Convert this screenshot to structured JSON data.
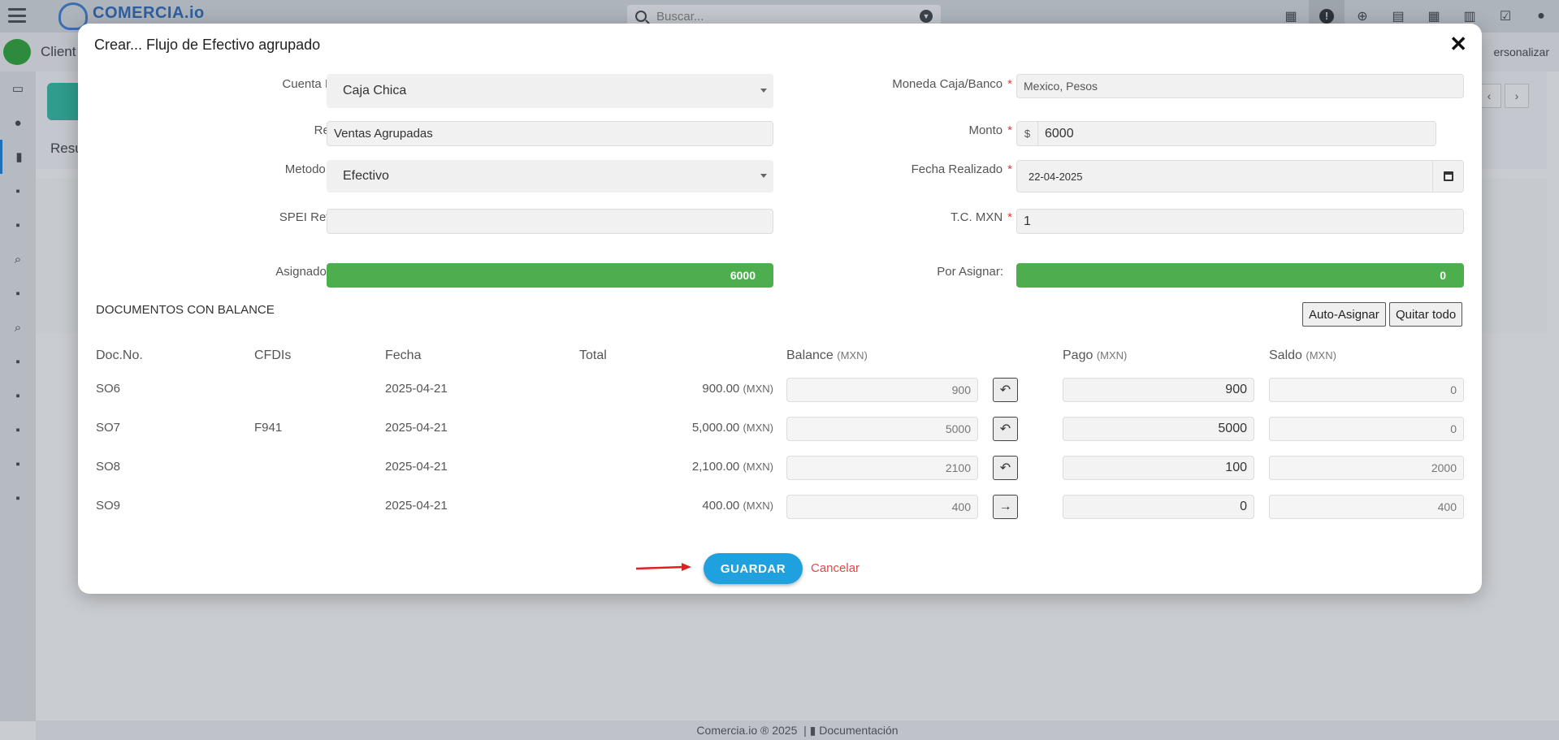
{
  "app": {
    "logo_text": "COMERCIA.io",
    "search_placeholder": "Buscar...",
    "section_label": "Client",
    "customize_label": "ersonalizar",
    "tab_label": "Resu",
    "footer_text": "Comercia.io ® 2025",
    "footer_doc_label": "Documentación"
  },
  "modal": {
    "title": "Crear... Flujo de Efectivo agrupado",
    "close_symbol": "✕",
    "fields": {
      "cuenta_label": "Cuenta Bancaria",
      "cuenta_value": "Caja Chica",
      "moneda_label": "Moneda Caja/Banco",
      "moneda_value": "Mexico, Pesos",
      "referencia_label": "Referencia",
      "referencia_value": "Ventas Agrupadas",
      "monto_label": "Monto",
      "monto_prefix": "$",
      "monto_value": "6000",
      "metodo_label": "Metodo de pago",
      "metodo_value": "Efectivo",
      "fecha_label": "Fecha Realizado",
      "fecha_value": "22-04-2025",
      "spei_label": "SPEI Ref. Numerica",
      "spei_value": "",
      "tc_label": "T.C. MXN",
      "tc_value": "1",
      "required_mark": "*"
    },
    "bars": {
      "asignado_label": "Asignado:",
      "asignado_value": "6000",
      "por_asignar_label": "Por Asignar:",
      "por_asignar_value": "0"
    },
    "documents": {
      "section_title": "DOCUMENTOS CON BALANCE",
      "auto_assign_label": "Auto-Asignar",
      "remove_all_label": "Quitar todo",
      "headers": {
        "doc_no": "Doc.No.",
        "cfdis": "CFDIs",
        "fecha": "Fecha",
        "total": "Total",
        "balance": "Balance",
        "pago": "Pago",
        "saldo": "Saldo",
        "currency": "(MXN)"
      },
      "rows": [
        {
          "doc": "SO6",
          "cfdi": "",
          "fecha": "2025-04-21",
          "total": "900.00",
          "cur": "(MXN)",
          "balance": "900",
          "action": "undo",
          "pago": "900",
          "saldo": "0"
        },
        {
          "doc": "SO7",
          "cfdi": "F941",
          "fecha": "2025-04-21",
          "total": "5,000.00",
          "cur": "(MXN)",
          "balance": "5000",
          "action": "undo",
          "pago": "5000",
          "saldo": "0"
        },
        {
          "doc": "SO8",
          "cfdi": "",
          "fecha": "2025-04-21",
          "total": "2,100.00",
          "cur": "(MXN)",
          "balance": "2100",
          "action": "undo",
          "pago": "100",
          "saldo": "2000"
        },
        {
          "doc": "SO9",
          "cfdi": "",
          "fecha": "2025-04-21",
          "total": "400.00",
          "cur": "(MXN)",
          "balance": "400",
          "action": "arrow-right",
          "pago": "0",
          "saldo": "400"
        }
      ]
    },
    "save_label": "GUARDAR",
    "cancel_label": "Cancelar"
  },
  "colors": {
    "accent_blue": "#1fa1e0",
    "bar_green": "#4cae4c",
    "required_red": "#e53935",
    "cancel_red": "#e04848"
  }
}
